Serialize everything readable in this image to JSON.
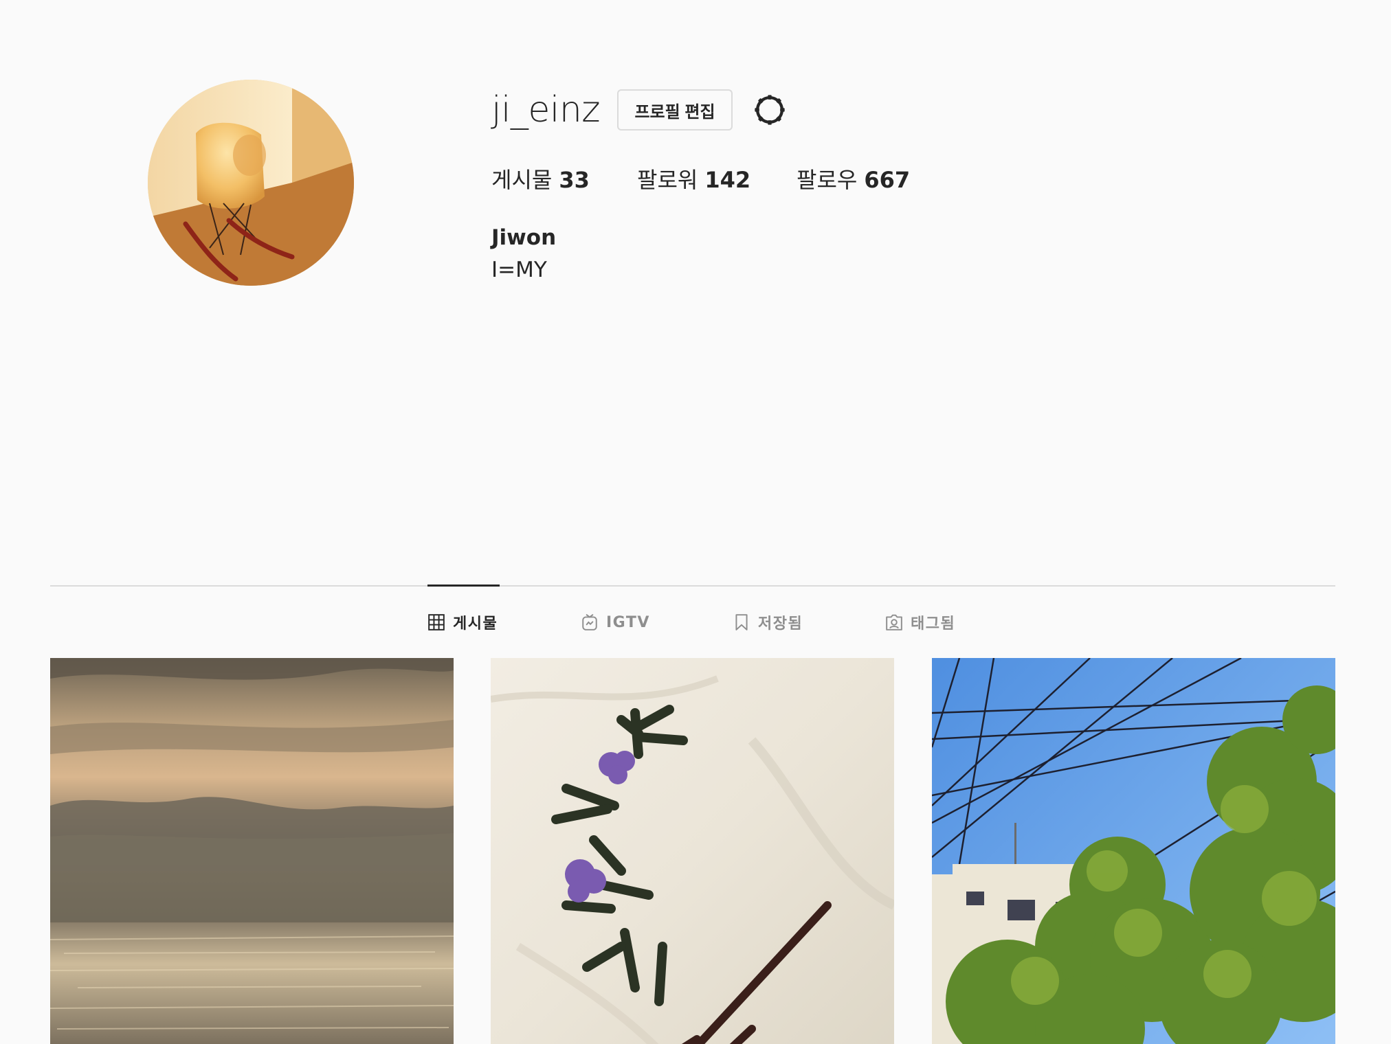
{
  "profile": {
    "username": "ji_einz",
    "edit_button_label": "프로필 편집",
    "settings_icon": "gear-icon",
    "full_name": "Jiwon",
    "bio": "I=MY"
  },
  "stats": {
    "posts_label": "게시물",
    "posts_count": "33",
    "followers_label": "팔로워",
    "followers_count": "142",
    "following_label": "팔로우",
    "following_count": "667"
  },
  "tabs": [
    {
      "label": "게시물",
      "icon": "grid-icon",
      "active": true
    },
    {
      "label": "IGTV",
      "icon": "igtv-icon",
      "active": false
    },
    {
      "label": "저장됨",
      "icon": "bookmark-icon",
      "active": false
    },
    {
      "label": "태그됨",
      "icon": "tagged-icon",
      "active": false
    }
  ],
  "colors": {
    "background": "#fafafa",
    "text_primary": "#262626",
    "text_secondary": "#8e8e8e",
    "border": "#dbdbdb"
  }
}
